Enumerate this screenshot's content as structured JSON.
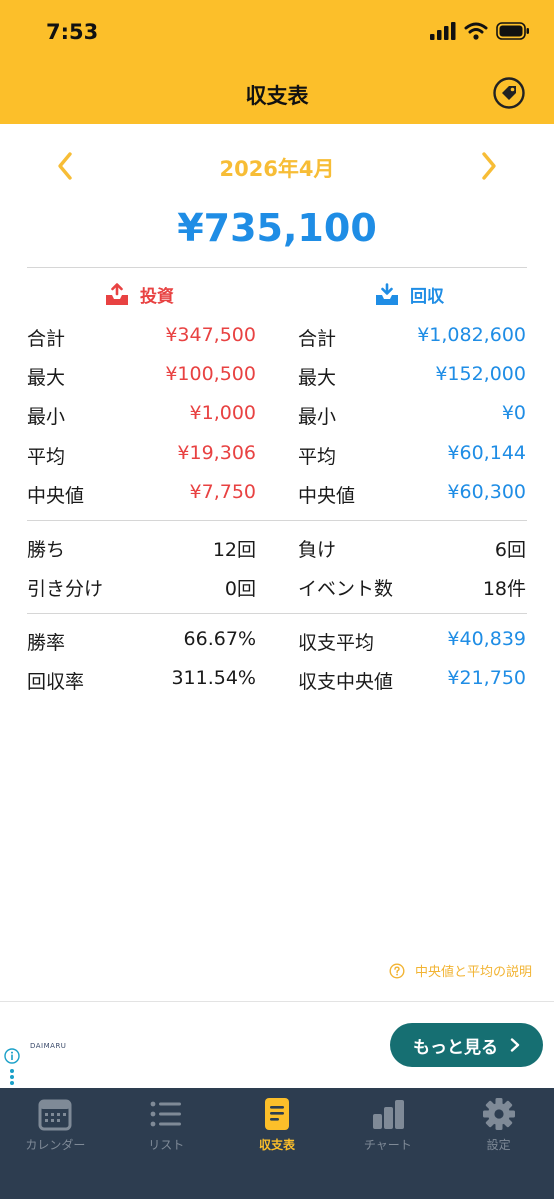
{
  "status": {
    "time": "7:53"
  },
  "header": {
    "title": "収支表"
  },
  "month": {
    "label": "2026年4月"
  },
  "summary": {
    "total": "¥735,100"
  },
  "invest": {
    "title": "投資",
    "rows": [
      {
        "label": "合計",
        "value": "¥347,500"
      },
      {
        "label": "最大",
        "value": "¥100,500"
      },
      {
        "label": "最小",
        "value": "¥1,000"
      },
      {
        "label": "平均",
        "value": "¥19,306"
      },
      {
        "label": "中央値",
        "value": "¥7,750"
      }
    ]
  },
  "return": {
    "title": "回収",
    "rows": [
      {
        "label": "合計",
        "value": "¥1,082,600"
      },
      {
        "label": "最大",
        "value": "¥152,000"
      },
      {
        "label": "最小",
        "value": "¥0"
      },
      {
        "label": "平均",
        "value": "¥60,144"
      },
      {
        "label": "中央値",
        "value": "¥60,300"
      }
    ]
  },
  "results": {
    "wins": {
      "label": "勝ち",
      "value": "12回"
    },
    "losses": {
      "label": "負け",
      "value": "6回"
    },
    "draws": {
      "label": "引き分け",
      "value": "0回"
    },
    "events": {
      "label": "イベント数",
      "value": "18件"
    }
  },
  "rates": {
    "win_rate": {
      "label": "勝率",
      "value": "66.67%"
    },
    "balance_avg": {
      "label": "収支平均",
      "value": "¥40,839"
    },
    "return_rate": {
      "label": "回収率",
      "value": "311.54%"
    },
    "balance_median": {
      "label": "収支中央値",
      "value": "¥21,750"
    }
  },
  "help": {
    "label": "中央値と平均の説明"
  },
  "ad": {
    "brand": "DAIMARU",
    "button_label": "もっと見る"
  },
  "tabs": [
    {
      "label": "カレンダー",
      "icon": "calendar-icon"
    },
    {
      "label": "リスト",
      "icon": "list-icon"
    },
    {
      "label": "収支表",
      "icon": "document-icon",
      "active": true
    },
    {
      "label": "チャート",
      "icon": "bar-chart-icon"
    },
    {
      "label": "設定",
      "icon": "gear-icon"
    }
  ],
  "colors": {
    "accent": "#fcbf2a",
    "invest": "#e84242",
    "return": "#1f8de5",
    "tabbar": "#2d3d50",
    "ad_button": "#166f72"
  }
}
